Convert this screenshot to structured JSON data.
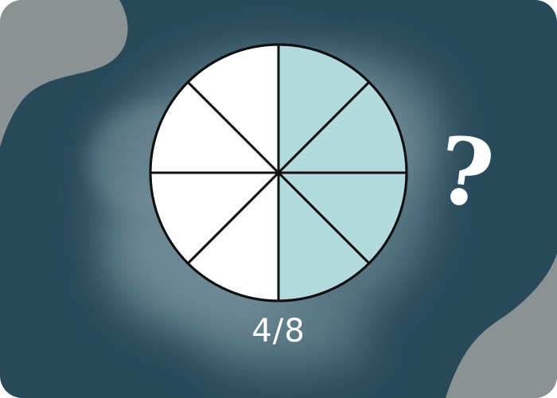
{
  "card": {
    "background_color": "#28495a",
    "blob_color": "#8a9294",
    "glow_color": "#7f9aa4"
  },
  "fraction_circle": {
    "total_parts": 8,
    "shaded_parts": 4,
    "shaded_side": "right",
    "shaded_color": "#b3dadd",
    "unshaded_color": "#ffffff",
    "outline_color": "#111111"
  },
  "fraction_label": "4/8",
  "question_icon": "question-mark-icon",
  "question_text": "?"
}
